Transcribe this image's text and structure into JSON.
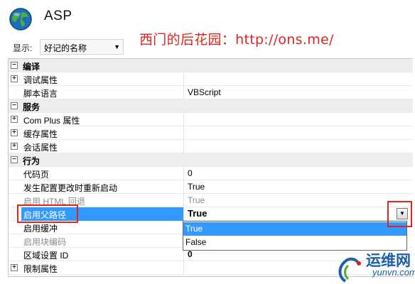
{
  "header": {
    "title": "ASP",
    "watermark": "西门的后花园：http://ons.me/"
  },
  "view": {
    "label": "显示:",
    "selected": "好记的名称"
  },
  "rows": [
    {
      "type": "category",
      "name": "编译",
      "toggle": "⊟"
    },
    {
      "type": "collapsed",
      "name": "调试属性",
      "value": ""
    },
    {
      "type": "prop",
      "name": "脚本语言",
      "value": "VBScript"
    },
    {
      "type": "category",
      "name": "服务",
      "toggle": "⊟"
    },
    {
      "type": "collapsed",
      "name": "Com Plus 属性",
      "value": ""
    },
    {
      "type": "collapsed",
      "name": "缓存属性",
      "value": ""
    },
    {
      "type": "collapsed",
      "name": "会话属性",
      "value": ""
    },
    {
      "type": "category",
      "name": "行为",
      "toggle": "⊟"
    },
    {
      "type": "prop",
      "name": "代码页",
      "value": "0"
    },
    {
      "type": "prop",
      "name": "发生配置更改时重新启动",
      "value": "True"
    },
    {
      "type": "disabled",
      "name": "启用 HTML 回退",
      "value": "True"
    },
    {
      "type": "selected",
      "name": "启用父路径",
      "value": "True"
    },
    {
      "type": "prop",
      "name": "启用缓冲",
      "value": ""
    },
    {
      "type": "disabled",
      "name": "启用块编码",
      "value": ""
    },
    {
      "type": "bold",
      "name": "区域设置 ID",
      "value": "0"
    },
    {
      "type": "collapsed",
      "name": "限制属性",
      "value": ""
    }
  ],
  "dropdown": {
    "options": [
      "True",
      "False"
    ],
    "highlighted": "True",
    "button_icon": "▼"
  },
  "logo": {
    "name": "运维网",
    "domain": "yunvn.com"
  },
  "colors": {
    "selection": "#3399ff",
    "annotation_red": "#e0241c",
    "category_bg": "#ededed",
    "logo_blue": "#1c5ea8"
  }
}
